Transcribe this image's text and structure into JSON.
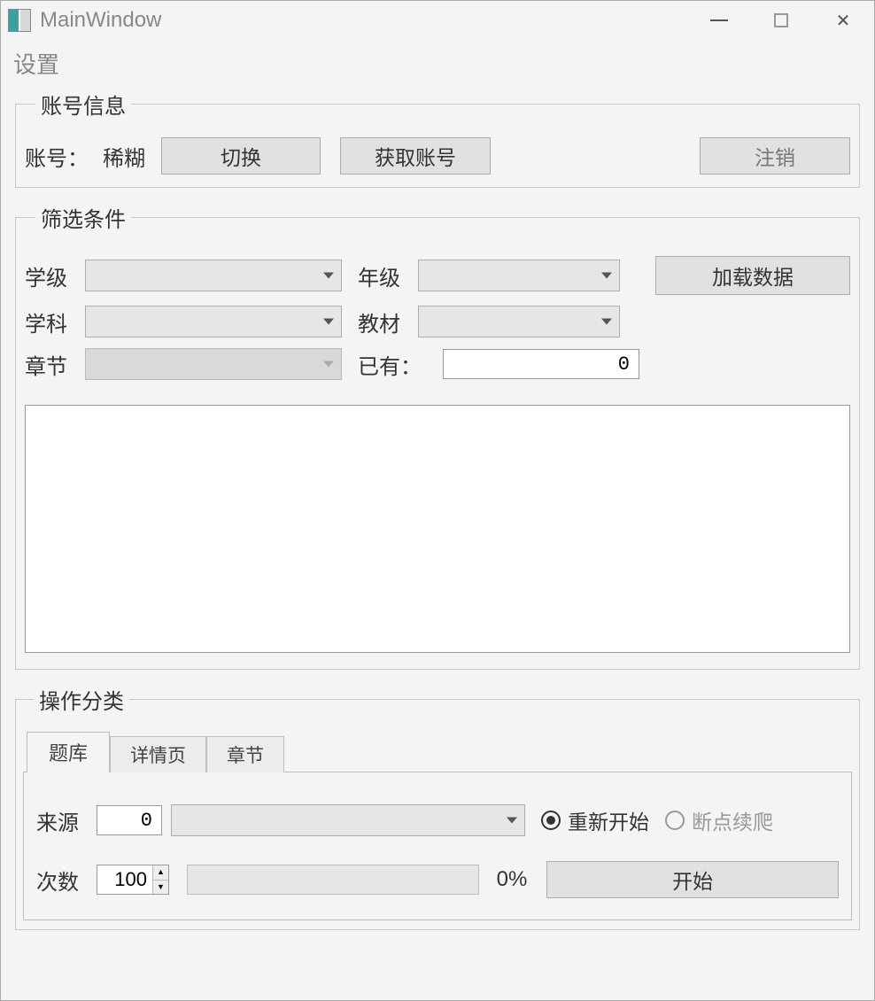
{
  "titlebar": {
    "title": "MainWindow"
  },
  "settings_label": "设置",
  "account_group": {
    "legend": "账号信息",
    "account_label": "账号：",
    "account_value": "稀糊",
    "switch_btn": "切换",
    "get_account_btn": "获取账号",
    "logout_btn": "注销"
  },
  "filter_group": {
    "legend": "筛选条件",
    "level_label": "学级",
    "grade_label": "年级",
    "load_btn": "加载数据",
    "subject_label": "学科",
    "textbook_label": "教材",
    "chapter_label": "章节",
    "existing_label": "已有：",
    "existing_value": "0"
  },
  "ops_group": {
    "legend": "操作分类",
    "tabs": {
      "bank": "题库",
      "detail": "详情页",
      "chapter": "章节"
    },
    "source_label": "来源",
    "source_value": "0",
    "radio_restart": "重新开始",
    "radio_resume": "断点续爬",
    "count_label": "次数",
    "count_value": "100",
    "progress_label": "0%",
    "start_btn": "开始"
  }
}
